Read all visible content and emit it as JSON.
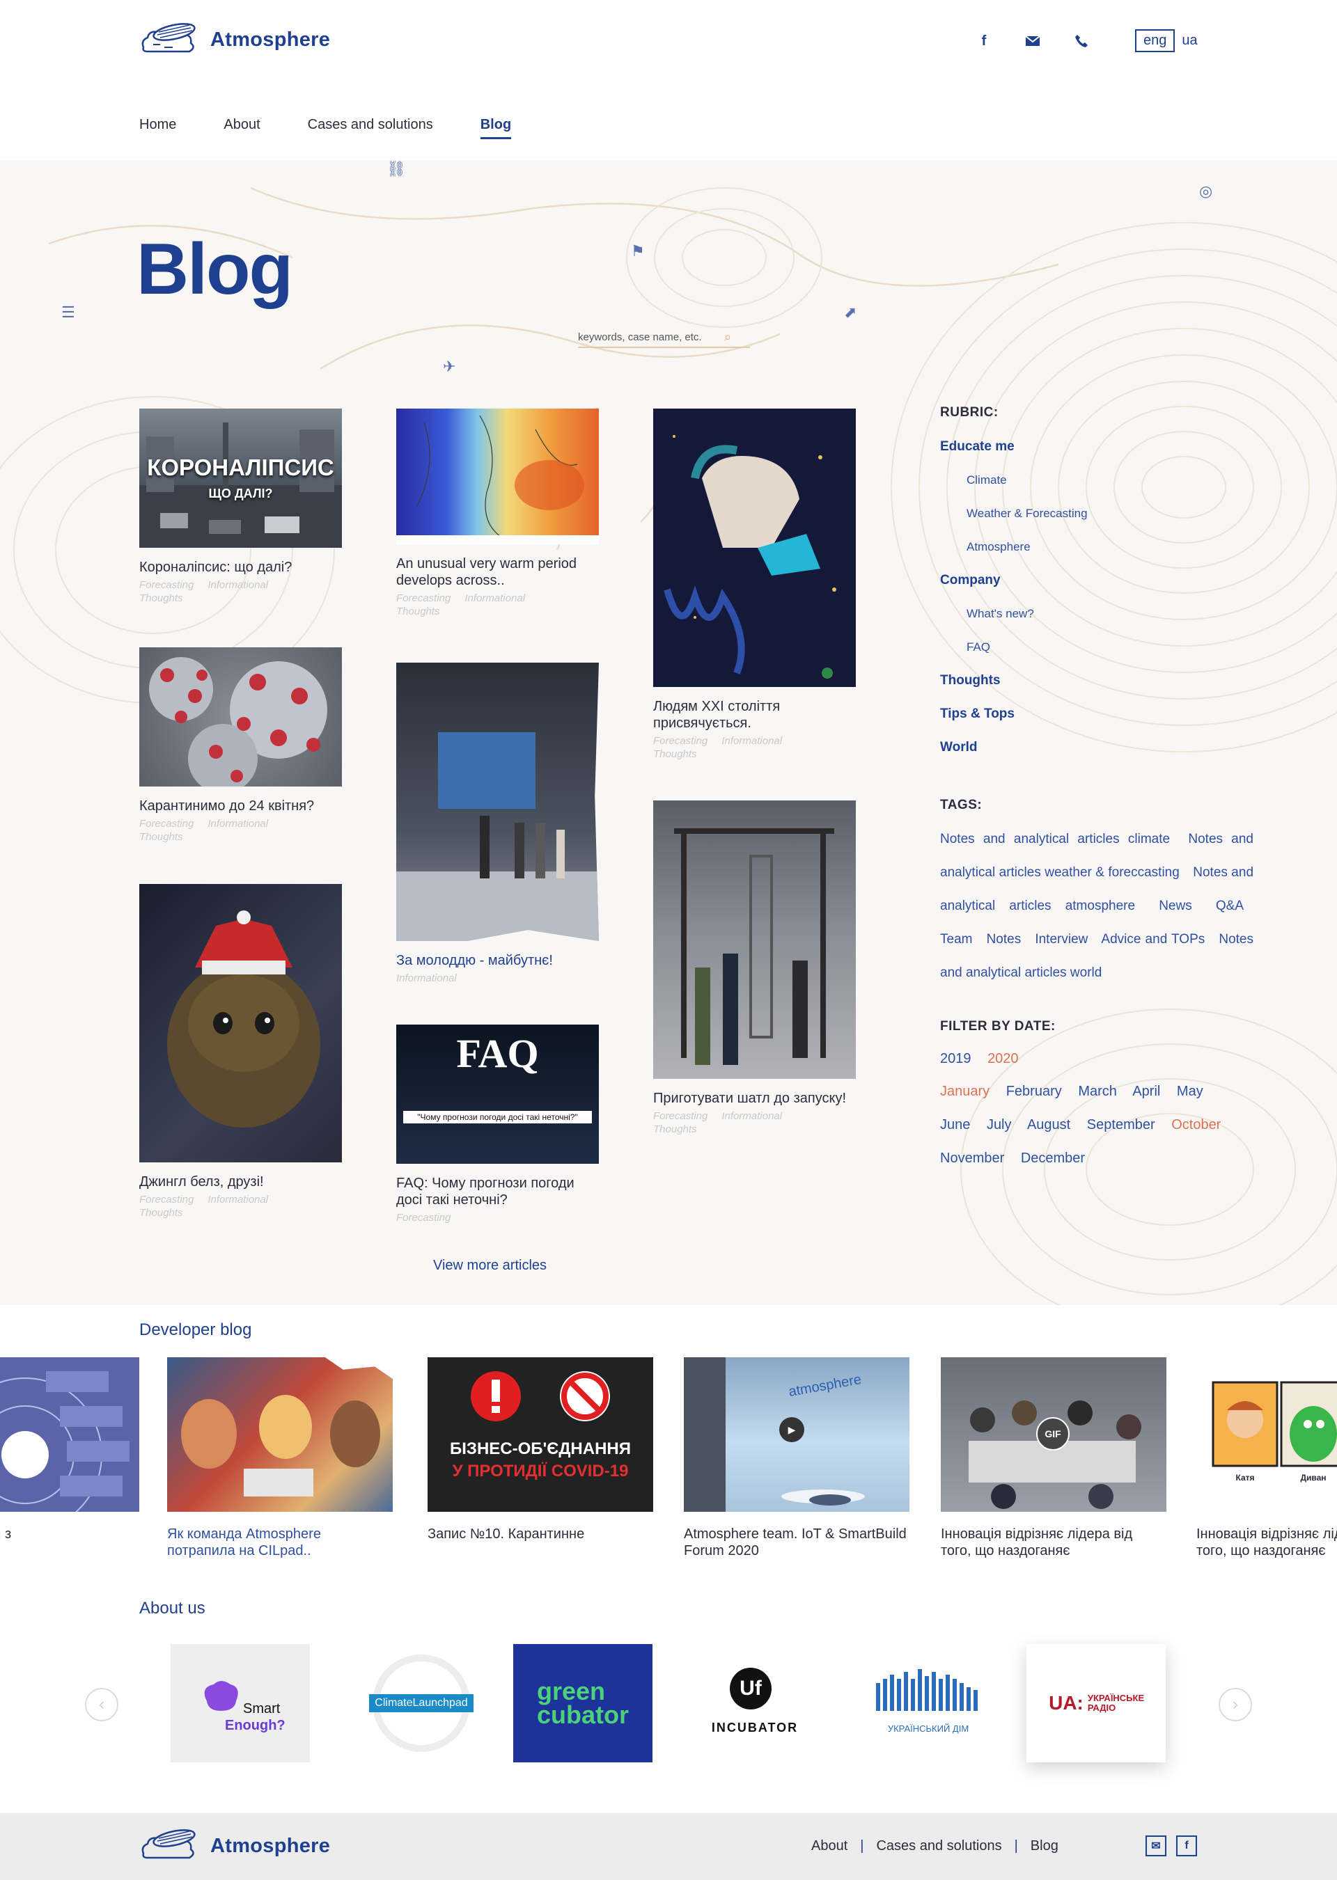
{
  "brand": {
    "name": "Atmosphere"
  },
  "header": {
    "socials": [
      "facebook-icon",
      "mail-icon",
      "phone-icon"
    ],
    "lang_active": "eng",
    "lang_other": "ua",
    "nav": [
      {
        "label": "Home",
        "active": false
      },
      {
        "label": "About",
        "active": false
      },
      {
        "label": "Cases and solutions",
        "active": false
      },
      {
        "label": "Blog",
        "active": true
      }
    ]
  },
  "page": {
    "title": "Blog",
    "search_placeholder": "keywords, case name, etc.",
    "view_more": "View more articles"
  },
  "articles": [
    {
      "title": "Короналіпсис: що далі?",
      "tags": [
        "Forecasting",
        "Informational",
        "Thoughts"
      ],
      "overlay": "КОРОНАЛІПСИС",
      "overlay2": "ЩО ДАЛІ?"
    },
    {
      "title": "Карантинимо до 24 квітня?",
      "tags": [
        "Forecasting",
        "Informational",
        "Thoughts"
      ]
    },
    {
      "title": "Джингл белз, друзі!",
      "tags": [
        "Forecasting",
        "Informational",
        "Thoughts"
      ]
    },
    {
      "title": "An unusual very warm period develops across..",
      "tags": [
        "Forecasting",
        "Informational",
        "Thoughts"
      ]
    },
    {
      "title": "За молоддю - майбутнє!",
      "tags": [
        "Informational"
      ]
    },
    {
      "title": "FAQ: Чому прогнози погоди досі такі неточні?",
      "tags": [
        "Forecasting"
      ],
      "overlay": "FAQ",
      "overlay2": "\"Чому прогнози погоди досі такі неточні?\""
    },
    {
      "title": "Людям XXI століття присвячується.",
      "tags": [
        "Forecasting",
        "Informational",
        "Thoughts"
      ]
    },
    {
      "title": "Приготувати шатл до запуску!",
      "tags": [
        "Forecasting",
        "Informational",
        "Thoughts"
      ]
    }
  ],
  "sidebar": {
    "rubric_label": "RUBRIC:",
    "rubric": [
      {
        "label": "Educate me",
        "sub": false
      },
      {
        "label": "Climate",
        "sub": true
      },
      {
        "label": "Weather & Forecasting",
        "sub": true
      },
      {
        "label": "Atmosphere",
        "sub": true
      },
      {
        "label": "Company",
        "sub": false
      },
      {
        "label": "What's new?",
        "sub": true
      },
      {
        "label": "FAQ",
        "sub": true
      },
      {
        "label": "Thoughts",
        "sub": false
      },
      {
        "label": "Tips & Tops",
        "sub": false
      },
      {
        "label": "World",
        "sub": false
      }
    ],
    "tags_label": "TAGS:",
    "tags": [
      "Notes and analytical articles climate",
      "Notes and analytical articles weather & foreccasting",
      "Notes and analytical articles atmosphere",
      "News",
      "Q&A",
      "Team",
      "Notes",
      "Interview",
      "Advice and TOPs",
      "Notes and analytical articles world"
    ],
    "filter_label": "FILTER BY DATE:",
    "years": [
      {
        "label": "2019",
        "hot": false
      },
      {
        "label": "2020",
        "hot": true
      }
    ],
    "months": [
      {
        "label": "January",
        "hot": true
      },
      {
        "label": "February",
        "hot": false
      },
      {
        "label": "March",
        "hot": false
      },
      {
        "label": "April",
        "hot": false
      },
      {
        "label": "May",
        "hot": false
      },
      {
        "label": "June",
        "hot": false
      },
      {
        "label": "July",
        "hot": false
      },
      {
        "label": "August",
        "hot": false
      },
      {
        "label": "September",
        "hot": false
      },
      {
        "label": "October",
        "hot": true
      },
      {
        "label": "November",
        "hot": false
      },
      {
        "label": "December",
        "hot": false
      }
    ]
  },
  "devblog": {
    "title": "Developer blog",
    "items": [
      {
        "title": "...авиперадки з",
        "link": false
      },
      {
        "title": "Як команда Atmosphere потрапила на CILpad..",
        "link": true
      },
      {
        "title": "Запис №10. Карантинне",
        "link": false,
        "overlay": "БІЗНЕС-ОБ'ЄДНАННЯ",
        "overlay2": "У ПРОТИДІЇ COVID-19"
      },
      {
        "title": "Atmosphere team. IoT & SmartBuild Forum 2020",
        "link": false,
        "overlay": "atmosphere"
      },
      {
        "title": "Інновація відрізняє лідера від того, що наздоганяє",
        "link": false,
        "overlay": "GIF"
      },
      {
        "title": "Інновація відрізняє лідера від того, що наздоганяє",
        "link": false,
        "overlay": "Катя",
        "overlay2": "Диван"
      }
    ]
  },
  "about": {
    "title": "About us",
    "partners": [
      {
        "name": "Smart",
        "name2": "Enough?"
      },
      {
        "name": "ClimateLaunchpad"
      },
      {
        "name": "green",
        "name2": "cubator"
      },
      {
        "name": "INCUBATOR"
      },
      {
        "name": "УКРАЇНСЬКИЙ ДІМ"
      },
      {
        "name": "UA:",
        "name2": "УКРАЇНСЬКЕ РАДІО"
      }
    ]
  },
  "footer": {
    "nav": [
      "About",
      "Cases and solutions",
      "Blog"
    ]
  },
  "colors": {
    "brand": "#1f3f8f",
    "accent": "#e07050",
    "sand": "#e6c9a7"
  }
}
